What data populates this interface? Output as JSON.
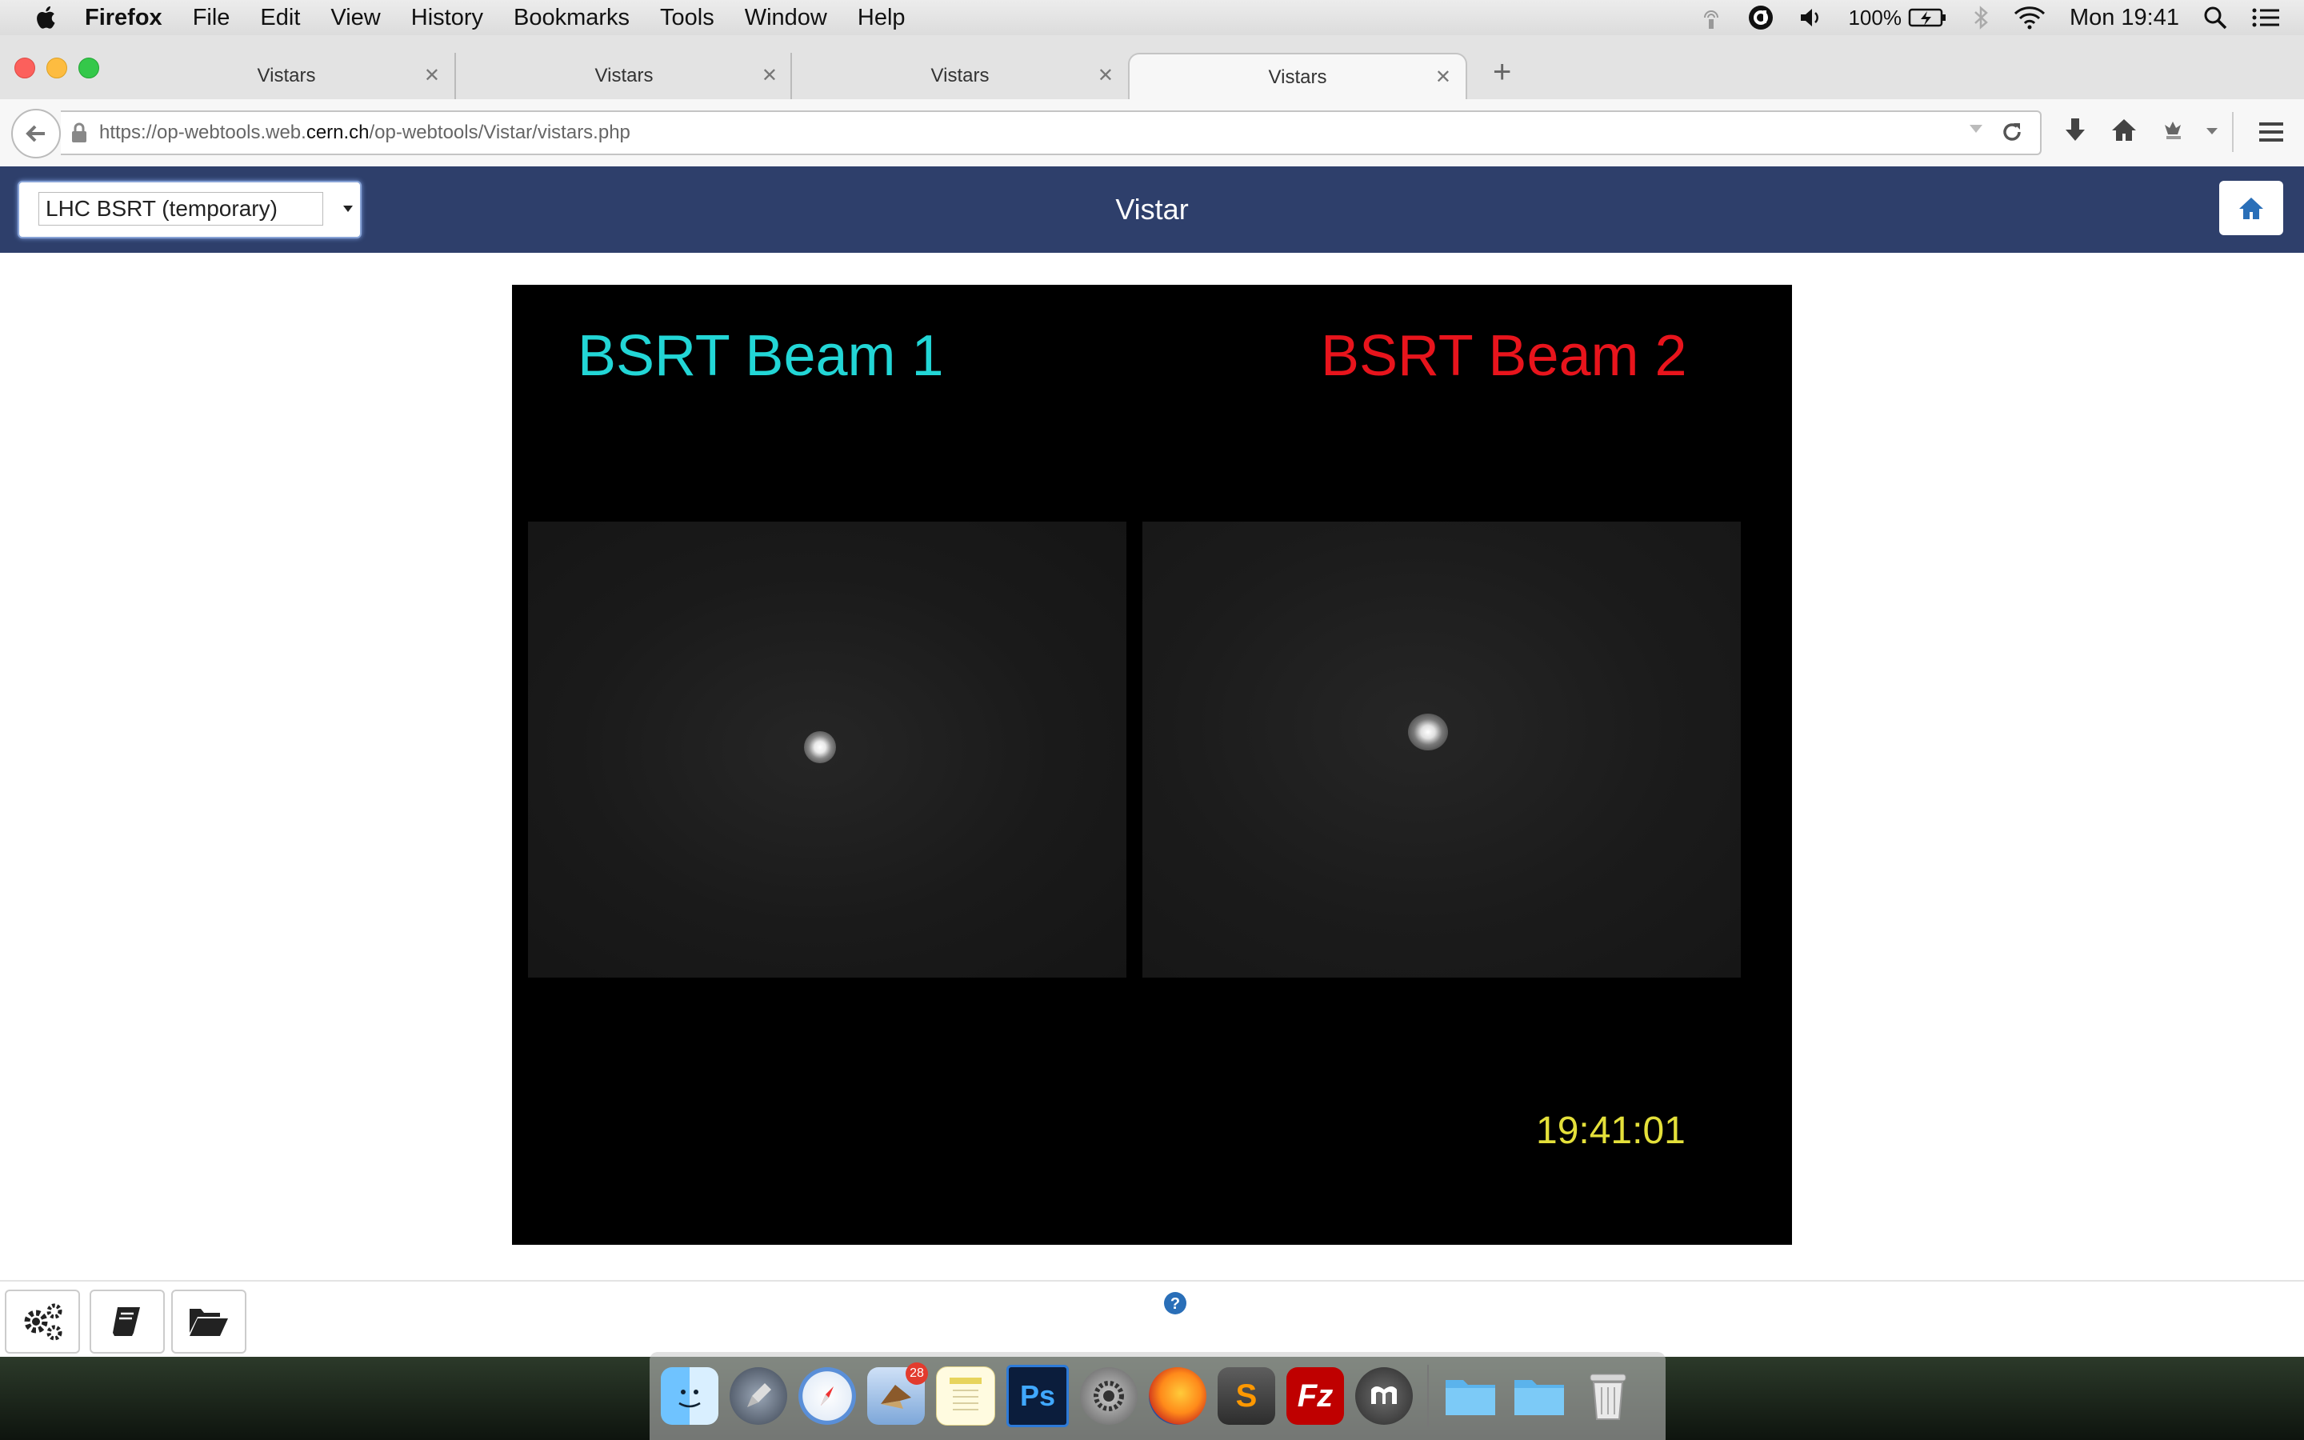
{
  "menubar": {
    "app_name": "Firefox",
    "menus": [
      "File",
      "Edit",
      "View",
      "History",
      "Bookmarks",
      "Tools",
      "Window",
      "Help"
    ],
    "battery": "100%",
    "clock": "Mon 19:41"
  },
  "browser": {
    "tabs": [
      {
        "label": "Vistars",
        "active": false
      },
      {
        "label": "Vistars",
        "active": false
      },
      {
        "label": "Vistars",
        "active": false
      },
      {
        "label": "Vistars",
        "active": true
      }
    ],
    "url_prefix": "https://op-webtools.web.",
    "url_domain": "cern.ch",
    "url_path": "/op-webtools/Vistar/vistars.php"
  },
  "app": {
    "title": "Vistar",
    "selected_vistar": "LHC BSRT (temporary)"
  },
  "vistar": {
    "beam1_title": "BSRT Beam 1",
    "beam2_title": "BSRT Beam 2",
    "timestamp": "19:41:01",
    "colors": {
      "beam1": "#22d6d6",
      "beam2": "#e8141c",
      "timestamp": "#e4e03a"
    }
  },
  "dock": {
    "mail_badge": "28",
    "icons": [
      "finder-icon",
      "launchpad-icon",
      "safari-icon",
      "mail-icon",
      "notes-icon",
      "photoshop-icon",
      "system-preferences-icon",
      "firefox-icon",
      "sublime-text-icon",
      "filezilla-icon",
      "macdown-icon",
      "folder-icon",
      "folder-icon",
      "trash-icon"
    ],
    "photoshop_label": "Ps",
    "sublime_label": "S",
    "filezilla_label": "Fz"
  },
  "colors": {
    "header_bg": "#2e3f6b",
    "home_icon": "#2a6fb8"
  }
}
